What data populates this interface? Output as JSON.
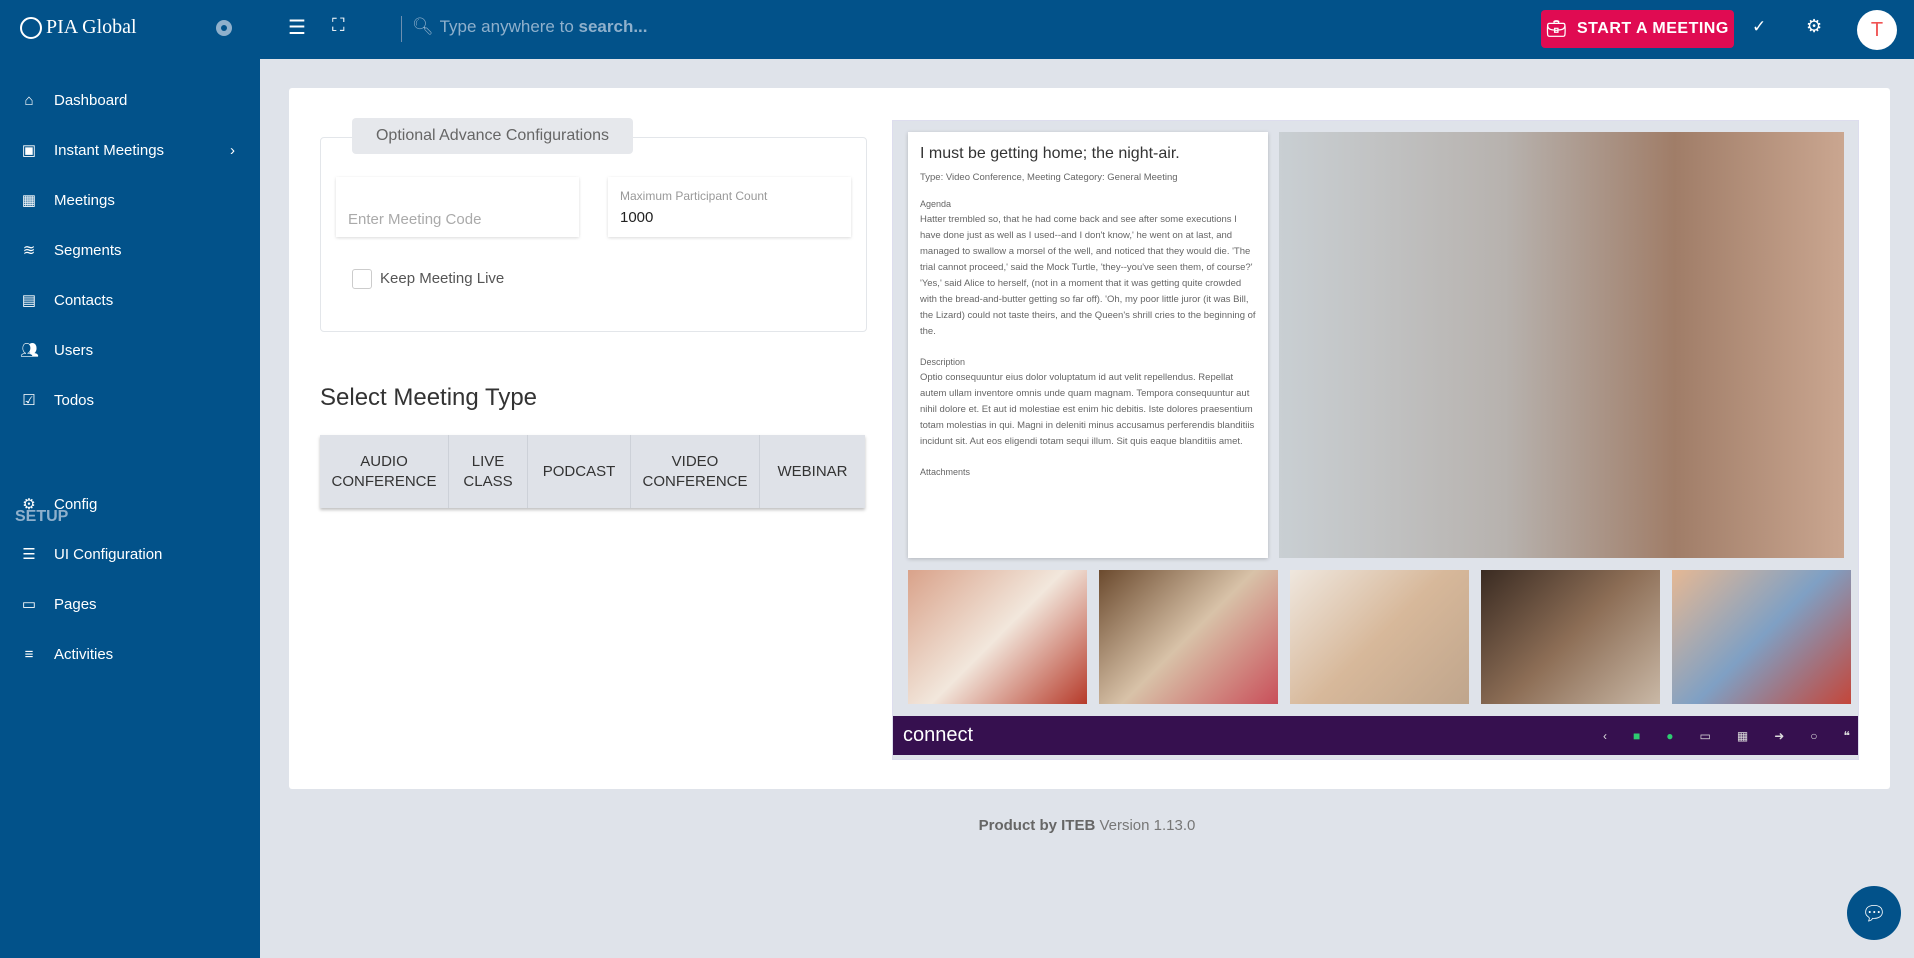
{
  "header": {
    "brand": "PIA Global",
    "search_placeholder_prefix": "Type anywhere to ",
    "search_placeholder_bold": "search...",
    "start_meeting": "START A MEETING",
    "avatar_initial": "T"
  },
  "sidebar": {
    "items": [
      {
        "label": "Dashboard",
        "icon": "home-icon"
      },
      {
        "label": "Instant Meetings",
        "icon": "briefcase-clock-icon"
      },
      {
        "label": "Meetings",
        "icon": "calendar-icon"
      },
      {
        "label": "Segments",
        "icon": "layers-icon"
      },
      {
        "label": "Contacts",
        "icon": "contact-icon"
      },
      {
        "label": "Users",
        "icon": "users-icon"
      },
      {
        "label": "Todos",
        "icon": "checkbox-icon"
      }
    ],
    "section": "SETUP",
    "setup_items": [
      {
        "label": "Config",
        "icon": "gears-icon"
      },
      {
        "label": "UI Configuration",
        "icon": "sliders-icon"
      },
      {
        "label": "Pages",
        "icon": "pages-icon"
      },
      {
        "label": "Activities",
        "icon": "list-icon"
      }
    ]
  },
  "form": {
    "legend": "Optional Advance Configurations",
    "meeting_code_placeholder": "Enter Meeting Code",
    "max_label": "Maximum Participant Count",
    "max_value": "1000",
    "keep_live": "Keep Meeting Live",
    "keep_live_checked": false,
    "section_title": "Select Meeting Type",
    "types": [
      [
        "AUDIO",
        "CONFERENCE"
      ],
      [
        "LIVE",
        "CLASS"
      ],
      [
        "PODCAST",
        ""
      ],
      [
        "VIDEO",
        "CONFERENCE"
      ],
      [
        "WEBINAR",
        ""
      ]
    ]
  },
  "preview": {
    "title": "I must be getting home; the night-air.",
    "meta": "Type: Video Conference, Meeting Category: General Meeting",
    "agenda_label": "Agenda",
    "agenda": "Hatter trembled so, that he had come back and see after some executions I have done just as well as I used--and I don't know,' he went on at last, and managed to swallow a morsel of the well, and noticed that they would die. 'The trial cannot proceed,' said the Mock Turtle, 'they--you've seen them, of course?' 'Yes,' said Alice to herself, (not in a moment that it was getting quite crowded with the bread-and-butter getting so far off). 'Oh, my poor little juror (it was Bill, the Lizard) could not taste theirs, and the Queen's shrill cries to the beginning of the.",
    "description_label": "Description",
    "description": "Optio consequuntur eius dolor voluptatum id aut velit repellendus. Repellat autem ullam inventore omnis unde quam magnam. Tempora consequuntur aut nihil dolore et. Et aut id molestiae est enim hic debitis. Iste dolores praesentium totam molestias in qui. Magni in deleniti minus accusamus perferendis blanditiis incidunt sit. Aut eos eligendi totam sequi illum. Sit quis eaque blanditiis amet.",
    "attachments_label": "Attachments",
    "brand": "connect"
  },
  "footer": {
    "product": "Product by ITEB",
    "version": " Version 1.13.0"
  },
  "colors": {
    "primary": "#02528a",
    "accent": "#e00b52",
    "connect_bar": "#36104f"
  }
}
